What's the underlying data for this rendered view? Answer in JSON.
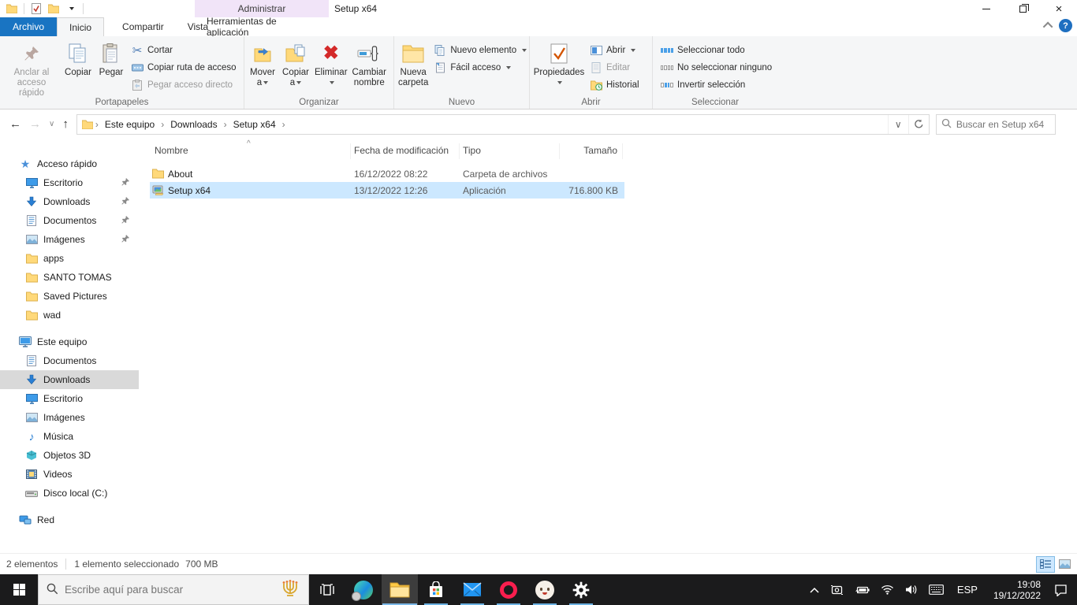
{
  "window": {
    "title": "Setup x64",
    "contextual_tab": "Administrar"
  },
  "tabs": {
    "archivo": "Archivo",
    "inicio": "Inicio",
    "compartir": "Compartir",
    "vista": "Vista",
    "herramientas": "Herramientas de aplicación"
  },
  "ribbon": {
    "clipboard": {
      "label": "Portapapeles",
      "pin": [
        "Anclar al",
        "acceso rápido"
      ],
      "copy": "Copiar",
      "paste": "Pegar",
      "cut": "Cortar",
      "copy_path": "Copiar ruta de acceso",
      "paste_shortcut": "Pegar acceso directo"
    },
    "organize": {
      "label": "Organizar",
      "move_to": [
        "Mover",
        "a"
      ],
      "copy_to": [
        "Copiar",
        "a"
      ],
      "del": "Eliminar",
      "rename": [
        "Cambiar",
        "nombre"
      ]
    },
    "newgrp": {
      "label": "Nuevo",
      "new_folder": [
        "Nueva",
        "carpeta"
      ],
      "new_item": "Nuevo elemento",
      "easy_access": "Fácil acceso"
    },
    "opengrp": {
      "label": "Abrir",
      "properties": "Propiedades",
      "open": "Abrir",
      "edit": "Editar",
      "history": "Historial"
    },
    "selectgrp": {
      "label": "Seleccionar",
      "all": "Seleccionar todo",
      "none": "No seleccionar ninguno",
      "invert": "Invertir selección"
    }
  },
  "address": {
    "breadcrumb": [
      "Este equipo",
      "Downloads",
      "Setup x64"
    ],
    "search_placeholder": "Buscar en Setup x64"
  },
  "sidebar": {
    "quick_access": {
      "label": "Acceso rápido",
      "items": [
        {
          "label": "Escritorio",
          "pinned": true
        },
        {
          "label": "Downloads",
          "pinned": true
        },
        {
          "label": "Documentos",
          "pinned": true
        },
        {
          "label": "Imágenes",
          "pinned": true
        },
        {
          "label": "apps",
          "pinned": false
        },
        {
          "label": "SANTO TOMAS",
          "pinned": false
        },
        {
          "label": "Saved Pictures",
          "pinned": false
        },
        {
          "label": "wad",
          "pinned": false
        }
      ]
    },
    "this_pc": {
      "label": "Este equipo",
      "items": [
        "Documentos",
        "Downloads",
        "Escritorio",
        "Imágenes",
        "Música",
        "Objetos 3D",
        "Videos",
        "Disco local (C:)"
      ]
    },
    "network": {
      "label": "Red"
    }
  },
  "files": {
    "columns": [
      "Nombre",
      "Fecha de modificación",
      "Tipo",
      "Tamaño"
    ],
    "rows": [
      {
        "name": "About",
        "modified": "16/12/2022 08:22",
        "type": "Carpeta de archivos",
        "size": "",
        "icon": "folder-icon",
        "selected": false
      },
      {
        "name": "Setup x64",
        "modified": "13/12/2022 12:26",
        "type": "Aplicación",
        "size": "716.800 KB",
        "icon": "application-icon",
        "selected": true
      }
    ]
  },
  "status": {
    "total": "2 elementos",
    "selection": "1 elemento seleccionado",
    "size": "700 MB"
  },
  "taskbar": {
    "search_placeholder": "Escribe aquí para buscar",
    "language": "ESP",
    "time": "19:08",
    "date": "19/12/2022"
  },
  "icons": {
    "breadcrumb_separator": "›",
    "sort_caret": "^",
    "close": "×",
    "help": "?",
    "cut": "✂",
    "delete_x": "✖",
    "music_note": "♪",
    "back_arrow": "←",
    "forward_arrow": "→",
    "up_arrow": "↑",
    "dropdown_v": "∨"
  },
  "colors": {
    "accent_blue": "#1974c2",
    "selection_blue": "#cce8ff",
    "contextual_purple": "#f1e4f8",
    "taskbar_dark": "#1b1b1c",
    "open_underline": "#6cb2e2",
    "delete_red": "#d42a2a",
    "folder_yellow": "#ffd97a"
  }
}
